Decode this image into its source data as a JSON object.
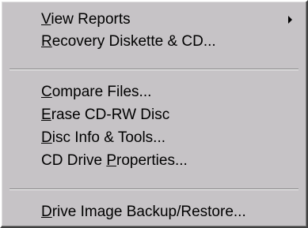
{
  "menu": {
    "items": [
      {
        "pre": "",
        "key": "V",
        "post": "iew Reports",
        "submenu": true
      },
      {
        "pre": "",
        "key": "R",
        "post": "ecovery Diskette & CD...",
        "submenu": false
      },
      {
        "pre": "",
        "key": "C",
        "post": "ompare Files...",
        "submenu": false
      },
      {
        "pre": "",
        "key": "E",
        "post": "rase CD-RW Disc",
        "submenu": false
      },
      {
        "pre": "",
        "key": "D",
        "post": "isc Info & Tools...",
        "submenu": false
      },
      {
        "pre": "CD Drive ",
        "key": "P",
        "post": "roperties...",
        "submenu": false
      },
      {
        "pre": "",
        "key": "D",
        "post": "rive Image Backup/Restore...",
        "submenu": false
      }
    ]
  },
  "icons": {
    "submenu_arrow": "chevron-right-icon"
  },
  "colors": {
    "menu_background": "#c6c3c6",
    "text": "#000000",
    "separator_dark": "#808080",
    "separator_light": "#ffffff"
  }
}
